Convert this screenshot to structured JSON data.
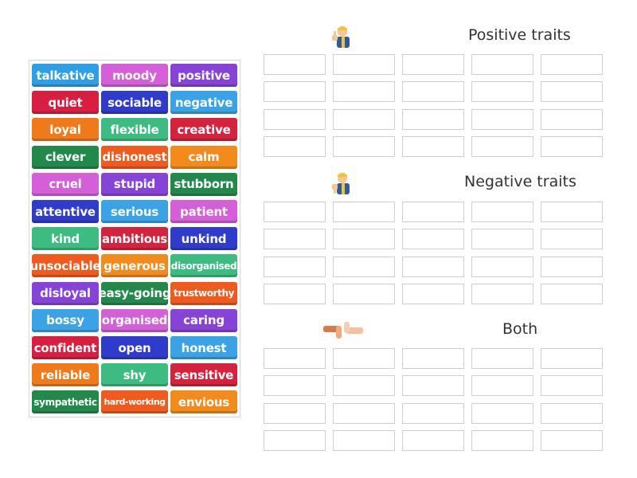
{
  "colors": {
    "blue_light": "#2e9ee6",
    "pink": "#d45fd8",
    "violet": "#8742d8",
    "red": "#d81f40",
    "navy": "#2f3bcc",
    "sky": "#3aa3e8",
    "orange": "#f07a19",
    "green_light": "#3cbc80",
    "crimson": "#d6233d",
    "green": "#21894a",
    "orange_red": "#f05a1c",
    "orange2": "#f28a1c"
  },
  "word_bank": [
    {
      "label": "talkative",
      "color": "#2e9ee6",
      "size": ""
    },
    {
      "label": "moody",
      "color": "#d45fd8",
      "size": ""
    },
    {
      "label": "positive",
      "color": "#8742d8",
      "size": ""
    },
    {
      "label": "quiet",
      "color": "#d81f40",
      "size": ""
    },
    {
      "label": "sociable",
      "color": "#2f3bcc",
      "size": ""
    },
    {
      "label": "negative",
      "color": "#3aa3e8",
      "size": ""
    },
    {
      "label": "loyal",
      "color": "#f07a19",
      "size": ""
    },
    {
      "label": "flexible",
      "color": "#3cbc80",
      "size": ""
    },
    {
      "label": "creative",
      "color": "#d6233d",
      "size": ""
    },
    {
      "label": "clever",
      "color": "#21894a",
      "size": ""
    },
    {
      "label": "dishonest",
      "color": "#f05a1c",
      "size": ""
    },
    {
      "label": "calm",
      "color": "#f28a1c",
      "size": ""
    },
    {
      "label": "cruel",
      "color": "#d45fd8",
      "size": ""
    },
    {
      "label": "stupid",
      "color": "#8742d8",
      "size": ""
    },
    {
      "label": "stubborn",
      "color": "#21894a",
      "size": ""
    },
    {
      "label": "attentive",
      "color": "#2f3bcc",
      "size": ""
    },
    {
      "label": "serious",
      "color": "#3aa3e8",
      "size": ""
    },
    {
      "label": "patient",
      "color": "#d45fd8",
      "size": ""
    },
    {
      "label": "kind",
      "color": "#3cbc80",
      "size": ""
    },
    {
      "label": "ambitious",
      "color": "#d6233d",
      "size": ""
    },
    {
      "label": "unkind",
      "color": "#2f3bcc",
      "size": ""
    },
    {
      "label": "unsociable",
      "color": "#f05a1c",
      "size": ""
    },
    {
      "label": "generous",
      "color": "#f28a1c",
      "size": ""
    },
    {
      "label": "disorganised",
      "color": "#3cbc80",
      "size": "small"
    },
    {
      "label": "disloyal",
      "color": "#8742d8",
      "size": ""
    },
    {
      "label": "easy-going",
      "color": "#21894a",
      "size": ""
    },
    {
      "label": "trustworthy",
      "color": "#f05a1c",
      "size": "small"
    },
    {
      "label": "bossy",
      "color": "#3aa3e8",
      "size": ""
    },
    {
      "label": "organised",
      "color": "#d45fd8",
      "size": ""
    },
    {
      "label": "caring",
      "color": "#8742d8",
      "size": ""
    },
    {
      "label": "confident",
      "color": "#d81f40",
      "size": ""
    },
    {
      "label": "open",
      "color": "#2f3bcc",
      "size": ""
    },
    {
      "label": "honest",
      "color": "#3aa3e8",
      "size": ""
    },
    {
      "label": "reliable",
      "color": "#f07a19",
      "size": ""
    },
    {
      "label": "shy",
      "color": "#3cbc80",
      "size": ""
    },
    {
      "label": "sensitive",
      "color": "#d6233d",
      "size": ""
    },
    {
      "label": "sympathetic",
      "color": "#21894a",
      "size": "small"
    },
    {
      "label": "hard-working",
      "color": "#f05a1c",
      "size": "xsmall"
    },
    {
      "label": "envious",
      "color": "#f28a1c",
      "size": ""
    }
  ],
  "groups": [
    {
      "title": "Positive traits",
      "icon": "thumbs-up-icon"
    },
    {
      "title": "Negative traits",
      "icon": "thumbs-down-icon"
    },
    {
      "title": "Both",
      "icon": "hands-icon"
    }
  ]
}
